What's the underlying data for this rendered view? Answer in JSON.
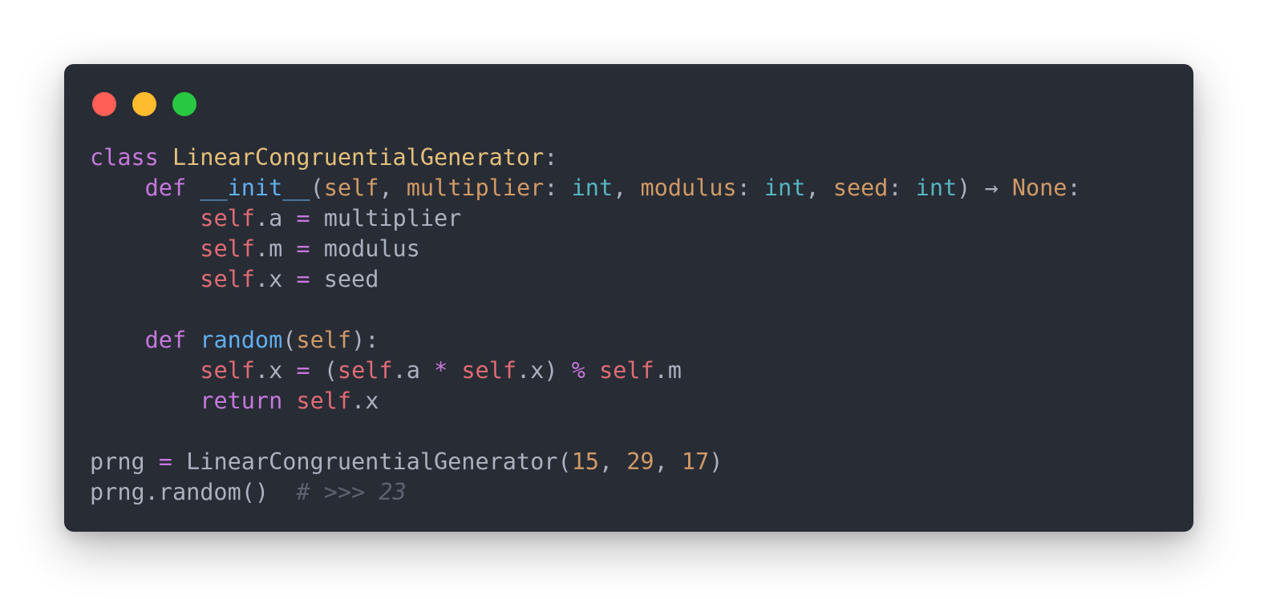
{
  "window": {
    "controls": [
      {
        "name": "close",
        "color": "#ff5f57"
      },
      {
        "name": "minimize",
        "color": "#febc2e"
      },
      {
        "name": "maximize",
        "color": "#28c840"
      }
    ]
  },
  "code": {
    "language": "python",
    "lines": [
      [
        {
          "t": "class",
          "k": "kw"
        },
        {
          "t": " ",
          "k": "plain"
        },
        {
          "t": "LinearCongruentialGenerator",
          "k": "cls"
        },
        {
          "t": ":",
          "k": "plain"
        }
      ],
      [
        {
          "t": "    ",
          "k": "plain"
        },
        {
          "t": "def",
          "k": "kw"
        },
        {
          "t": " ",
          "k": "plain"
        },
        {
          "t": "__init__",
          "k": "fn"
        },
        {
          "t": "(",
          "k": "plain"
        },
        {
          "t": "self",
          "k": "param"
        },
        {
          "t": ", ",
          "k": "plain"
        },
        {
          "t": "multiplier",
          "k": "param"
        },
        {
          "t": ": ",
          "k": "plain"
        },
        {
          "t": "int",
          "k": "type"
        },
        {
          "t": ", ",
          "k": "plain"
        },
        {
          "t": "modulus",
          "k": "param"
        },
        {
          "t": ": ",
          "k": "plain"
        },
        {
          "t": "int",
          "k": "type"
        },
        {
          "t": ", ",
          "k": "plain"
        },
        {
          "t": "seed",
          "k": "param"
        },
        {
          "t": ": ",
          "k": "plain"
        },
        {
          "t": "int",
          "k": "type"
        },
        {
          "t": ") ",
          "k": "plain"
        },
        {
          "t": "→",
          "k": "plain"
        },
        {
          "t": " ",
          "k": "plain"
        },
        {
          "t": "None",
          "k": "none"
        },
        {
          "t": ":",
          "k": "plain"
        }
      ],
      [
        {
          "t": "        ",
          "k": "plain"
        },
        {
          "t": "self",
          "k": "self"
        },
        {
          "t": ".a ",
          "k": "plain"
        },
        {
          "t": "=",
          "k": "op"
        },
        {
          "t": " multiplier",
          "k": "plain"
        }
      ],
      [
        {
          "t": "        ",
          "k": "plain"
        },
        {
          "t": "self",
          "k": "self"
        },
        {
          "t": ".m ",
          "k": "plain"
        },
        {
          "t": "=",
          "k": "op"
        },
        {
          "t": " modulus",
          "k": "plain"
        }
      ],
      [
        {
          "t": "        ",
          "k": "plain"
        },
        {
          "t": "self",
          "k": "self"
        },
        {
          "t": ".x ",
          "k": "plain"
        },
        {
          "t": "=",
          "k": "op"
        },
        {
          "t": " seed",
          "k": "plain"
        }
      ],
      [],
      [
        {
          "t": "    ",
          "k": "plain"
        },
        {
          "t": "def",
          "k": "kw"
        },
        {
          "t": " ",
          "k": "plain"
        },
        {
          "t": "random",
          "k": "fn"
        },
        {
          "t": "(",
          "k": "plain"
        },
        {
          "t": "self",
          "k": "param"
        },
        {
          "t": "):",
          "k": "plain"
        }
      ],
      [
        {
          "t": "        ",
          "k": "plain"
        },
        {
          "t": "self",
          "k": "self"
        },
        {
          "t": ".x ",
          "k": "plain"
        },
        {
          "t": "=",
          "k": "op"
        },
        {
          "t": " (",
          "k": "plain"
        },
        {
          "t": "self",
          "k": "self"
        },
        {
          "t": ".a ",
          "k": "plain"
        },
        {
          "t": "*",
          "k": "op"
        },
        {
          "t": " ",
          "k": "plain"
        },
        {
          "t": "self",
          "k": "self"
        },
        {
          "t": ".x) ",
          "k": "plain"
        },
        {
          "t": "%",
          "k": "op"
        },
        {
          "t": " ",
          "k": "plain"
        },
        {
          "t": "self",
          "k": "self"
        },
        {
          "t": ".m",
          "k": "plain"
        }
      ],
      [
        {
          "t": "        ",
          "k": "plain"
        },
        {
          "t": "return",
          "k": "kw"
        },
        {
          "t": " ",
          "k": "plain"
        },
        {
          "t": "self",
          "k": "self"
        },
        {
          "t": ".x",
          "k": "plain"
        }
      ],
      [],
      [
        {
          "t": "prng ",
          "k": "plain"
        },
        {
          "t": "=",
          "k": "op"
        },
        {
          "t": " LinearCongruentialGenerator(",
          "k": "plain"
        },
        {
          "t": "15",
          "k": "num"
        },
        {
          "t": ", ",
          "k": "plain"
        },
        {
          "t": "29",
          "k": "num"
        },
        {
          "t": ", ",
          "k": "plain"
        },
        {
          "t": "17",
          "k": "num"
        },
        {
          "t": ")",
          "k": "plain"
        }
      ],
      [
        {
          "t": "prng.random()",
          "k": "plain"
        },
        {
          "t": "  ",
          "k": "plain"
        },
        {
          "t": "# >>> 23",
          "k": "comment"
        }
      ]
    ]
  }
}
